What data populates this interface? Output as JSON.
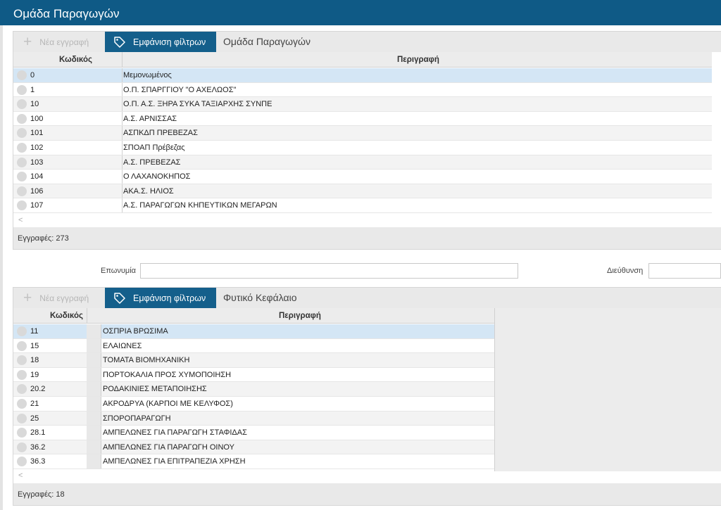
{
  "window": {
    "title": "Ομάδα Παραγωγών"
  },
  "top_panel": {
    "toolbar": {
      "new_label": "Νέα εγγραφή",
      "filter_label": "Εμφάνιση φίλτρων",
      "caption": "Ομάδα Παραγωγών"
    },
    "columns": {
      "code": "Κωδικός",
      "description": "Περιγραφή"
    },
    "rows": [
      {
        "code": "0",
        "description": "Μεμονωμένος"
      },
      {
        "code": "1",
        "description": "Ο.Π. ΣΠΑΡΓΓΙΟΥ \"Ο ΑΧΕΛΩΟΣ\""
      },
      {
        "code": "10",
        "description": "Ο.Π. Α.Σ. ΞΗΡΑ ΣΥΚΑ ΤΑΞΙΑΡΧΗΣ ΣΥΝΠΕ"
      },
      {
        "code": "100",
        "description": "Α.Σ. ΑΡΝΙΣΣΑΣ"
      },
      {
        "code": "101",
        "description": "ΑΣΠΚΔΠ ΠΡΕΒΕΖΑΣ"
      },
      {
        "code": "102",
        "description": "ΣΠΟΑΠ Πρέβεζας"
      },
      {
        "code": "103",
        "description": "Α.Σ. ΠΡΕΒΕΖΑΣ"
      },
      {
        "code": "104",
        "description": "Ο ΛΑΧΑΝΟΚΗΠΟΣ"
      },
      {
        "code": "106",
        "description": "ΑΚΑ.Σ. ΗΛΙΟΣ"
      },
      {
        "code": "107",
        "description": "Α.Σ. ΠΑΡΑΓΩΓΩΝ ΚΗΠΕΥΤΙΚΩΝ ΜΕΓΑΡΩΝ"
      }
    ],
    "footer": "Εγγραφές: 273"
  },
  "filters": {
    "name_label": "Επωνυμία",
    "name_value": "",
    "address_label": "Διεύθυνση",
    "address_value": ""
  },
  "bottom_panel": {
    "toolbar": {
      "new_label": "Νέα εγγραφή",
      "filter_label": "Εμφάνιση φίλτρων",
      "caption": "Φυτικό Κεφάλαιο"
    },
    "columns": {
      "code": "Κωδικός",
      "description": "Περιγραφή"
    },
    "rows": [
      {
        "code": "11",
        "description": "ΟΣΠΡΙΑ ΒΡΩΣΙΜΑ"
      },
      {
        "code": "15",
        "description": "ΕΛΑΙΩΝΕΣ"
      },
      {
        "code": "18",
        "description": "ΤΟΜΑΤΑ ΒΙΟΜΗΧΑΝΙΚΗ"
      },
      {
        "code": "19",
        "description": "ΠΟΡΤΟΚΑΛΙΑ ΠΡΟΣ ΧΥΜΟΠΟΙΗΣΗ"
      },
      {
        "code": "20.2",
        "description": "ΡΟΔΑΚΙΝΙΕΣ ΜΕΤΑΠΟΙΗΣΗΣ"
      },
      {
        "code": "21",
        "description": "ΑΚΡΟΔΡΥΑ (ΚΑΡΠΟΙ ΜΕ ΚΕΛΥΦΟΣ)"
      },
      {
        "code": "25",
        "description": "ΣΠΟΡΟΠΑΡΑΓΩΓΗ"
      },
      {
        "code": "28.1",
        "description": "ΑΜΠΕΛΩΝΕΣ ΓΙΑ ΠΑΡΑΓΩΓΗ ΣΤΑΦΙΔΑΣ"
      },
      {
        "code": "36.2",
        "description": "ΑΜΠΕΛΩΝΕΣ ΓΙΑ ΠΑΡΑΓΩΓΗ ΟΙΝΟΥ"
      },
      {
        "code": "36.3",
        "description": "ΑΜΠΕΛΩΝΕΣ ΓΙΑ ΕΠΙΤΡΑΠΕΖΙΑ ΧΡΗΣΗ"
      }
    ],
    "footer": "Εγγραφές: 18"
  },
  "colors": {
    "title_bar": "#0f5a86",
    "filter_button": "#145f8b",
    "selected_row": "#d4e6f5",
    "alt_row": "#f3f3f3"
  },
  "icons": {
    "new": "plus-icon",
    "filter": "tag-icon",
    "row_selector": "radio-icon"
  }
}
